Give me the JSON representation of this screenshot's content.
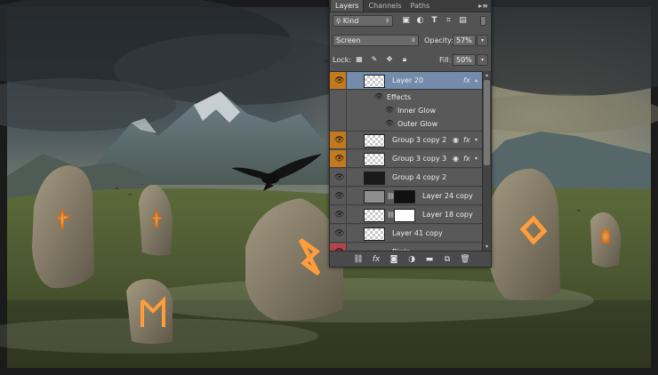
{
  "panel": {
    "tabs": [
      "Layers",
      "Channels",
      "Paths"
    ],
    "active_tab": "Layers",
    "menu_icon": "panel-menu-icon",
    "filter": {
      "kind_label": "Kind",
      "filter_icons": [
        "image-filter-icon",
        "adjustment-filter-icon",
        "type-filter-icon",
        "shape-filter-icon",
        "smart-object-filter-icon"
      ]
    },
    "blend_mode": "Screen",
    "opacity_label": "Opacity:",
    "opacity_value": "57%",
    "lock_label": "Lock:",
    "lock_icons": [
      "lock-transparent-icon",
      "lock-image-icon",
      "lock-position-icon",
      "lock-all-icon"
    ],
    "fill_label": "Fill:",
    "fill_value": "50%",
    "layers": [
      {
        "name": "Layer 20",
        "selected": true,
        "has_fx": true,
        "eye": "orange"
      },
      {
        "name": "Effects",
        "sub": true
      },
      {
        "name": "Inner Glow",
        "sub": true
      },
      {
        "name": "Outer Glow",
        "sub": true
      },
      {
        "name": "Group 3 copy 2",
        "has_fx": true,
        "eye": "orange"
      },
      {
        "name": "Group 3 copy 3",
        "has_fx": true,
        "eye": "orange"
      },
      {
        "name": "Group 4 copy 2"
      },
      {
        "name": "Layer 24 copy"
      },
      {
        "name": "Layer 18 copy"
      },
      {
        "name": "Layer 41 copy"
      },
      {
        "name": "Birds",
        "eye": "red",
        "is_folder": true
      }
    ],
    "fx_label": "fx",
    "bottom_icons": [
      "link-layers-icon",
      "fx-icon",
      "add-mask-icon",
      "new-adjustment-icon",
      "new-group-icon",
      "new-layer-icon",
      "trash-icon"
    ]
  },
  "colors": {
    "panel_bg": "#535353",
    "selected_row": "#748bab",
    "eye_orange": "#c37a1e",
    "eye_red": "#b8424a"
  }
}
